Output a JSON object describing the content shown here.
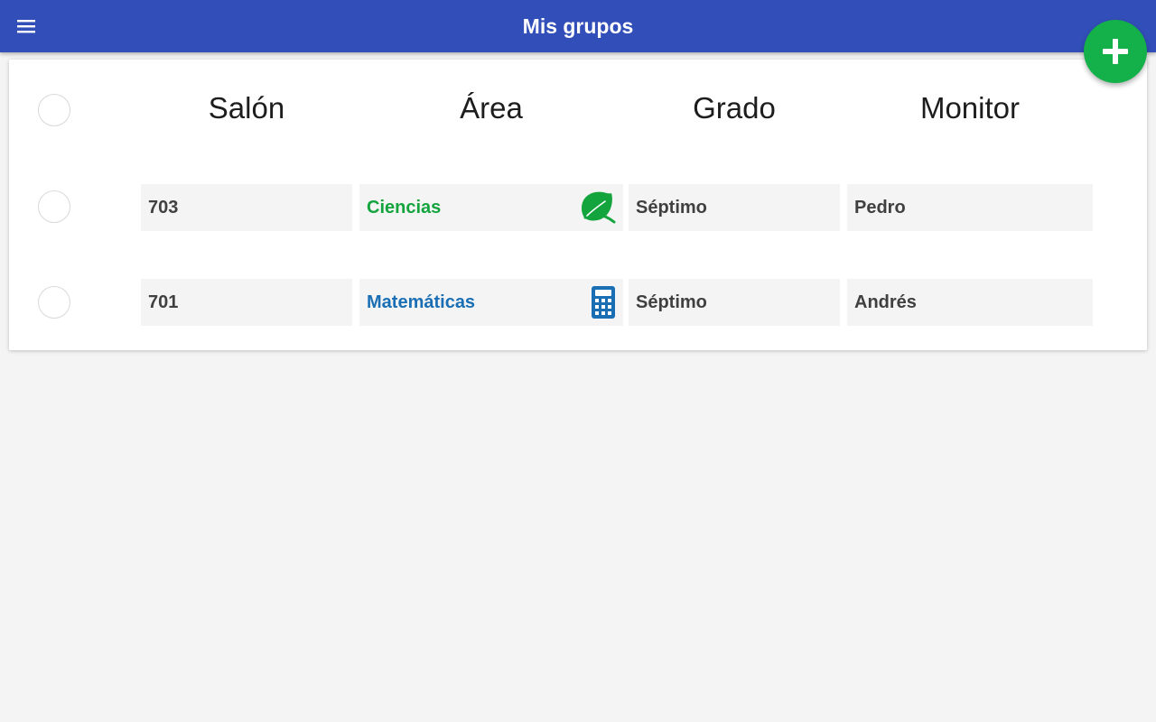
{
  "appbar": {
    "title": "Mis grupos",
    "menu_icon": "hamburger-menu-icon"
  },
  "fab": {
    "icon": "plus-icon",
    "color": "#14b04a"
  },
  "table": {
    "headers": {
      "salon": "Salón",
      "area": "Área",
      "grado": "Grado",
      "monitor": "Monitor"
    },
    "rows": [
      {
        "salon": "703",
        "area": "Ciencias",
        "area_icon": "leaf-icon",
        "area_color": "#13a43e",
        "grado": "Séptimo",
        "monitor": "Pedro"
      },
      {
        "salon": "701",
        "area": "Matemáticas",
        "area_icon": "calculator-icon",
        "area_color": "#1a6fb4",
        "grado": "Séptimo",
        "monitor": "Andrés"
      }
    ]
  },
  "colors": {
    "appbar": "#324eb8",
    "background": "#f4f4f4",
    "card": "#ffffff"
  }
}
